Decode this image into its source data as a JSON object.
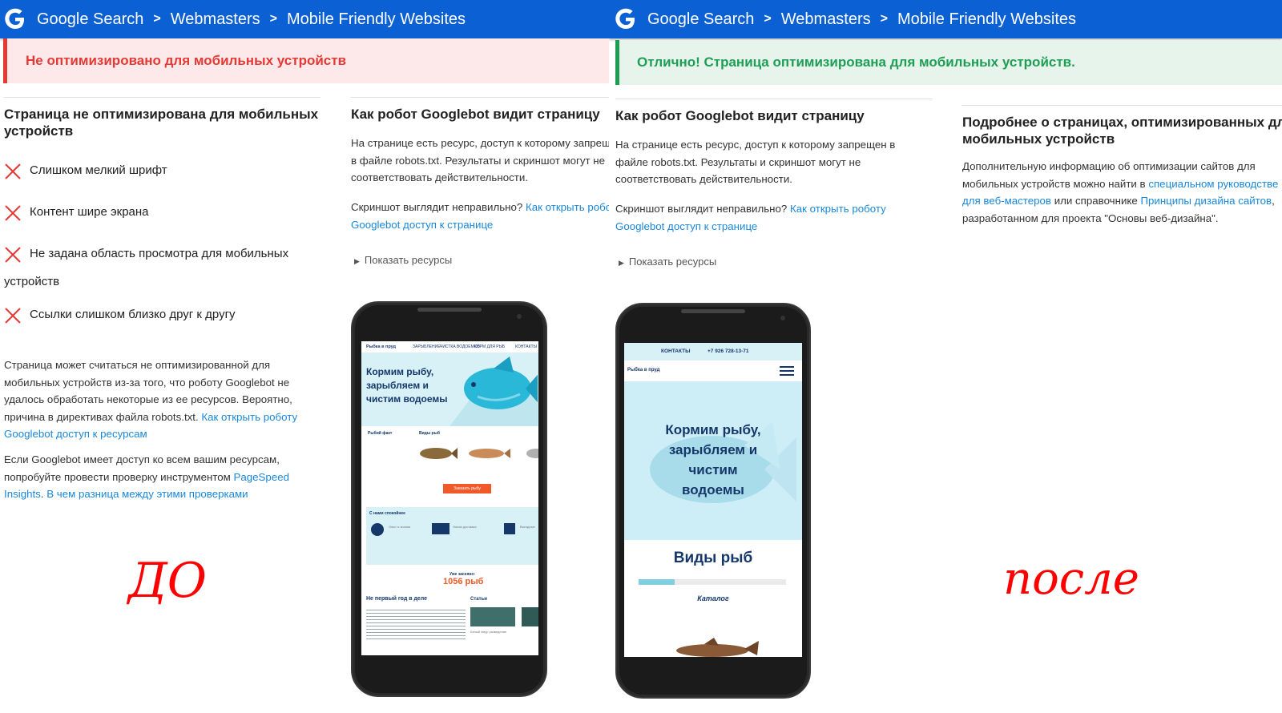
{
  "left": {
    "breadcrumb": [
      "Google Search",
      "Webmasters",
      "Mobile Friendly Websites"
    ],
    "banner": "Не оптимизировано для мобильных устройств",
    "issues_title": "Страница не оптимизирована для мобильных устройств",
    "issues": [
      "Слишком мелкий шрифт",
      "Контент шире экрана",
      "Не задана область просмотра для мобильных",
      "Ссылки слишком близко друг к другу"
    ],
    "issue_wrap": "устройств",
    "explanation": {
      "text": "Страница может считаться не оптимизированной для мобильных устройств из-за того, что роботу Googlebot не удалось обработать некоторые из ее ресурсов. Вероятно, причина в директивах файла robots.txt.",
      "link": "Как открыть роботу Googlebot доступ к ресурсам"
    },
    "pagespeed": {
      "text": "Если Googlebot имеет доступ ко всем вашим ресурсам, попробуйте провести проверку инструментом",
      "link1": "PageSpeed Insights",
      "link2": "В чем разница между этими проверками"
    },
    "googlebot": {
      "title": "Как робот Googlebot видит страницу",
      "text": "На странице есть ресурс, доступ к которому запрещен в файле robots.txt. Результаты и скриншот могут не соответствовать действительности.",
      "question": "Скриншот выглядит неправильно?",
      "link": "Как открыть роботу Googlebot доступ к странице",
      "toggle": "Показать ресурсы"
    },
    "handwritten": "ДО",
    "mini_site": {
      "logo": "Рыбка в пруд",
      "nav": [
        "ЗАРЫБЛЕНИЕ",
        "ЧИСТКА ВОДОЕМОВ",
        "КОРМ ДЛЯ РЫБ",
        "КОНТАКТЫ"
      ],
      "hero": "Кормим рыбу, зарыбляем и чистим водоемы",
      "fact_title": "Рыбий факт",
      "species_title": "Виды рыб",
      "order_button": "Заказать рыбу",
      "calm_title": "С нами спокойнее",
      "calm_items": [
        "Опыт и знания",
        "Умная доставка",
        "Выгодные"
      ],
      "stocked_label": "Уже засеяно:",
      "stocked_value": "1056 рыб",
      "years_title": "Не первый год в деле",
      "articles_title": "Статьи",
      "article_caption": "Белый амур разведение"
    }
  },
  "right": {
    "breadcrumb": [
      "Google Search",
      "Webmasters",
      "Mobile Friendly Websites"
    ],
    "banner": "Отлично! Страница оптимизирована для мобильных устройств.",
    "googlebot": {
      "title": "Как робот Googlebot видит страницу",
      "text": "На странице есть ресурс, доступ к которому запрещен в файле robots.txt. Результаты и скриншот могут не соответствовать действительности.",
      "question": "Скриншот выглядит неправильно?",
      "link": "Как открыть роботу Googlebot доступ к странице",
      "toggle": "Показать ресурсы"
    },
    "more": {
      "title": "Подробнее о страницах, оптимизированных для мобильных устройств",
      "text1": "Дополнительную информацию об оптимизации сайтов для мобильных устройств можно найти в",
      "link1": "специальном руководстве для веб-мастеров",
      "text2": "или справочнике",
      "link2": "Принципы дизайна сайтов",
      "text3": ", разработанном для проекта \"Основы веб-дизайна\"."
    },
    "handwritten": "после",
    "mini_site": {
      "contacts": "КОНТАКТЫ",
      "phone": "+7 926 728-13-71",
      "logo": "Рыбка в пруд",
      "hero": "Кормим рыбу, зарыбляем и чистим водоемы",
      "species_title": "Виды рыб",
      "catalog": "Каталог"
    }
  },
  "colors": {
    "topbar": "#0b60d4",
    "error": "#e53935",
    "success": "#1e9e55",
    "link": "#1a88d8",
    "handwriting": "#ff0000"
  },
  "icons": [
    "google-g-icon",
    "breadcrumb-chevron-icon",
    "cross-icon",
    "triangle-right-icon",
    "hamburger-menu-icon"
  ]
}
